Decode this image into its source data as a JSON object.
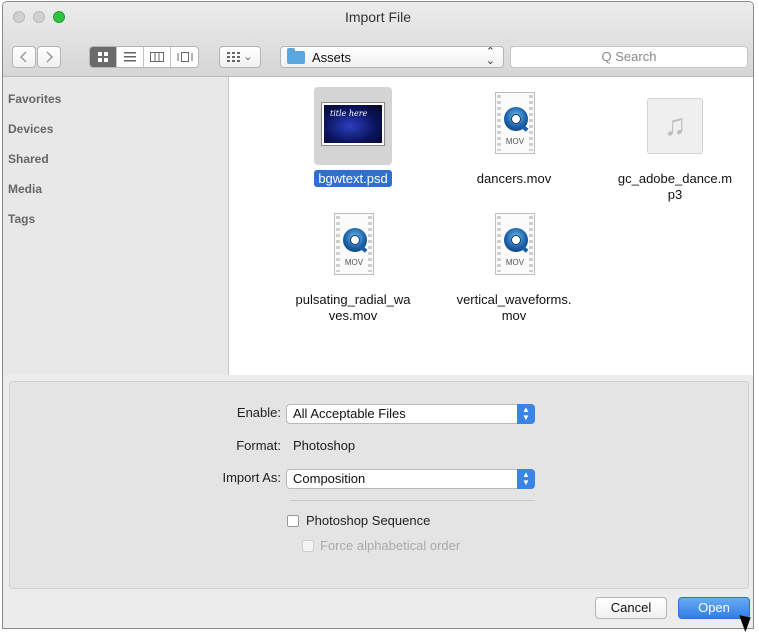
{
  "window": {
    "title": "Import File"
  },
  "toolbar": {
    "back_icon": "chevron-left-icon",
    "forward_icon": "chevron-right-icon",
    "view_icons": [
      "icon-view-icon",
      "list-view-icon",
      "column-view-icon",
      "coverflow-view-icon"
    ],
    "arrange_icon": "arrange-grid-icon",
    "arrange_chevron": "⌄",
    "location": "Assets",
    "search_placeholder": "Q Search"
  },
  "sidebar": {
    "items": [
      {
        "label": "Favorites"
      },
      {
        "label": "Devices"
      },
      {
        "label": "Shared"
      },
      {
        "label": "Media"
      },
      {
        "label": "Tags"
      }
    ]
  },
  "files": [
    {
      "name": "bgwtext.psd",
      "type": "psd",
      "selected": true,
      "thumb_text": "title here"
    },
    {
      "name": "dancers.mov",
      "type": "mov",
      "badge": "MOV"
    },
    {
      "name": "gc_adobe_dance.m\np3",
      "type": "mp3"
    },
    {
      "name": "pulsating_radial_wa\nves.mov",
      "type": "mov",
      "badge": "MOV"
    },
    {
      "name": "vertical_waveforms.\nmov",
      "type": "mov",
      "badge": "MOV"
    }
  ],
  "options": {
    "enable_label": "Enable:",
    "enable_value": "All Acceptable Files",
    "format_label": "Format:",
    "format_value": "Photoshop",
    "import_as_label": "Import As:",
    "import_as_value": "Composition",
    "sequence_label": "Photoshop Sequence",
    "sequence_checked": false,
    "force_label": "Force alphabetical order",
    "force_checked": false,
    "force_enabled": false
  },
  "buttons": {
    "cancel": "Cancel",
    "open": "Open"
  },
  "colors": {
    "accent": "#3a84e4",
    "selection": "#2e6fcf",
    "zoom_button": "#2fc241"
  }
}
